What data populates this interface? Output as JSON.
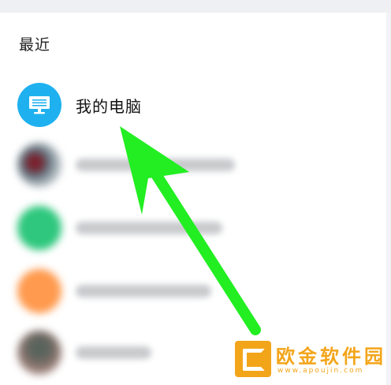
{
  "section": {
    "title": "最近"
  },
  "recent": {
    "items": [
      {
        "label": "我的电脑",
        "avatar": "computer-icon",
        "avatar_color": "#1fb1ef"
      },
      {
        "avatar": "contact-photo"
      },
      {
        "avatar": "contact-avatar",
        "avatar_color": "#2ec77d"
      },
      {
        "avatar": "contact-avatar",
        "avatar_color": "#ff9a4e"
      },
      {
        "avatar": "contact-photo"
      }
    ]
  },
  "overlay": {
    "arrow_color": "#22ee22"
  },
  "watermark": {
    "title": "欧金软件园",
    "url": "www.apoujin.com",
    "color": "#f3a51a"
  }
}
